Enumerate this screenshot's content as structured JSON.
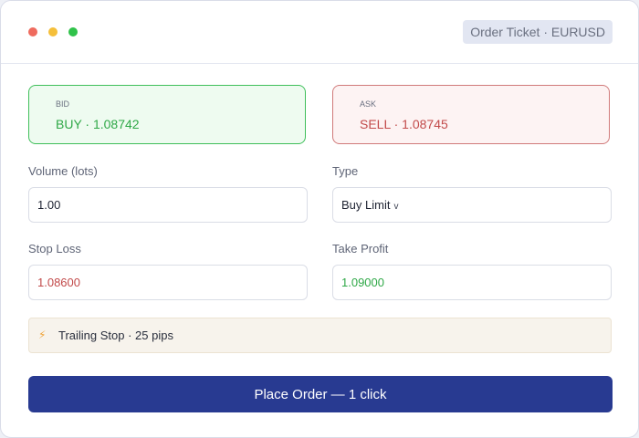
{
  "window": {
    "title": "Order Ticket · EURUSD"
  },
  "quotes": {
    "bid": {
      "label": "BID",
      "value": "BUY · 1.08742"
    },
    "ask": {
      "label": "ASK",
      "value": "SELL · 1.08745"
    }
  },
  "form": {
    "volume": {
      "label": "Volume (lots)",
      "value": "1.00"
    },
    "type": {
      "label": "Type",
      "value": "Buy Limit",
      "caret": "v"
    },
    "stop_loss": {
      "label": "Stop Loss",
      "value": "1.08600"
    },
    "take_profit": {
      "label": "Take Profit",
      "value": "1.09000"
    }
  },
  "trailing_stop": {
    "icon": "lightning-icon",
    "text": "Trailing Stop · 25 pips"
  },
  "submit": {
    "label": "Place Order — 1 click"
  },
  "colors": {
    "buy": "#2fa847",
    "sell": "#c24a4a",
    "primary": "#283a91",
    "accent": "#f0a43a"
  }
}
